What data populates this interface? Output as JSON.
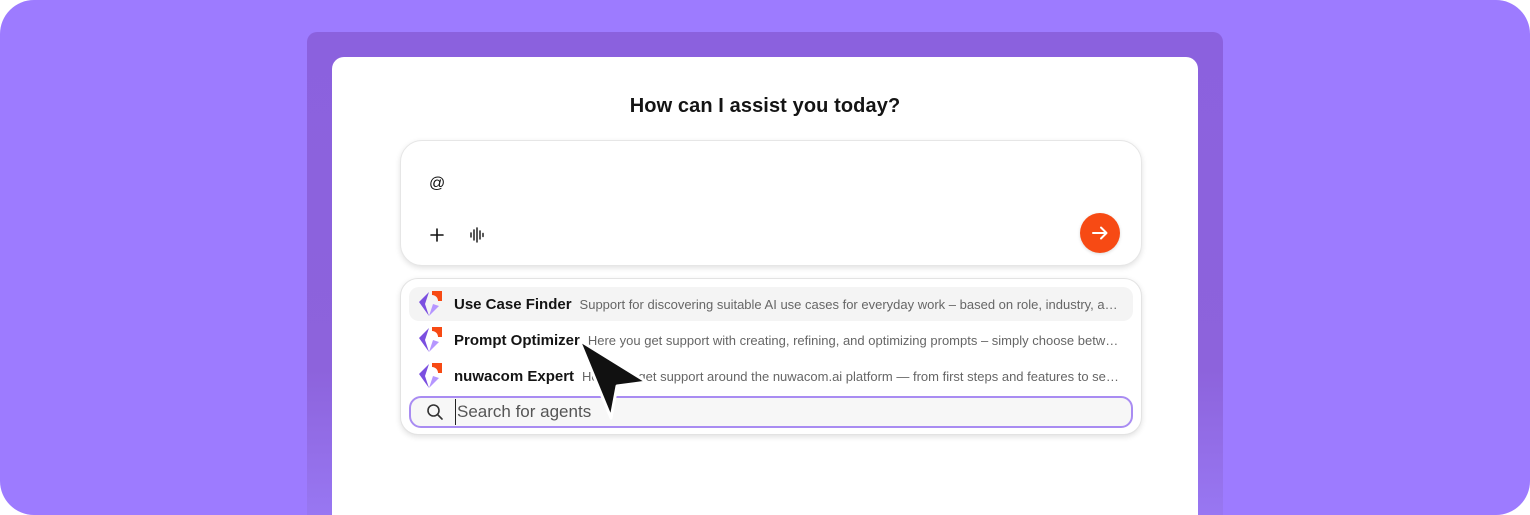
{
  "heading": "How can I assist you today?",
  "composer": {
    "text": "@",
    "add_icon": "plus-icon",
    "voice_icon": "voice-waveform-icon",
    "send_icon": "arrow-right-icon",
    "send_color": "#f74a14"
  },
  "agents": [
    {
      "name": "Use Case Finder",
      "description": "Support for discovering suitable AI use cases for everyday work – based on role, industry, and …"
    },
    {
      "name": "Prompt Optimizer",
      "description": "Here you get support with creating, refining, and optimizing prompts – simply choose betwe…"
    },
    {
      "name": "nuwacom Expert",
      "description": "Here you get support around the nuwacom.ai platform — from first steps and features to se…"
    }
  ],
  "search": {
    "placeholder": "Search for agents",
    "icon": "search-icon"
  },
  "colors": {
    "background": "#9d7bff",
    "accent_border": "#a98cf2",
    "logo_purple": "#7b4fe0",
    "logo_orange": "#f74a14"
  }
}
